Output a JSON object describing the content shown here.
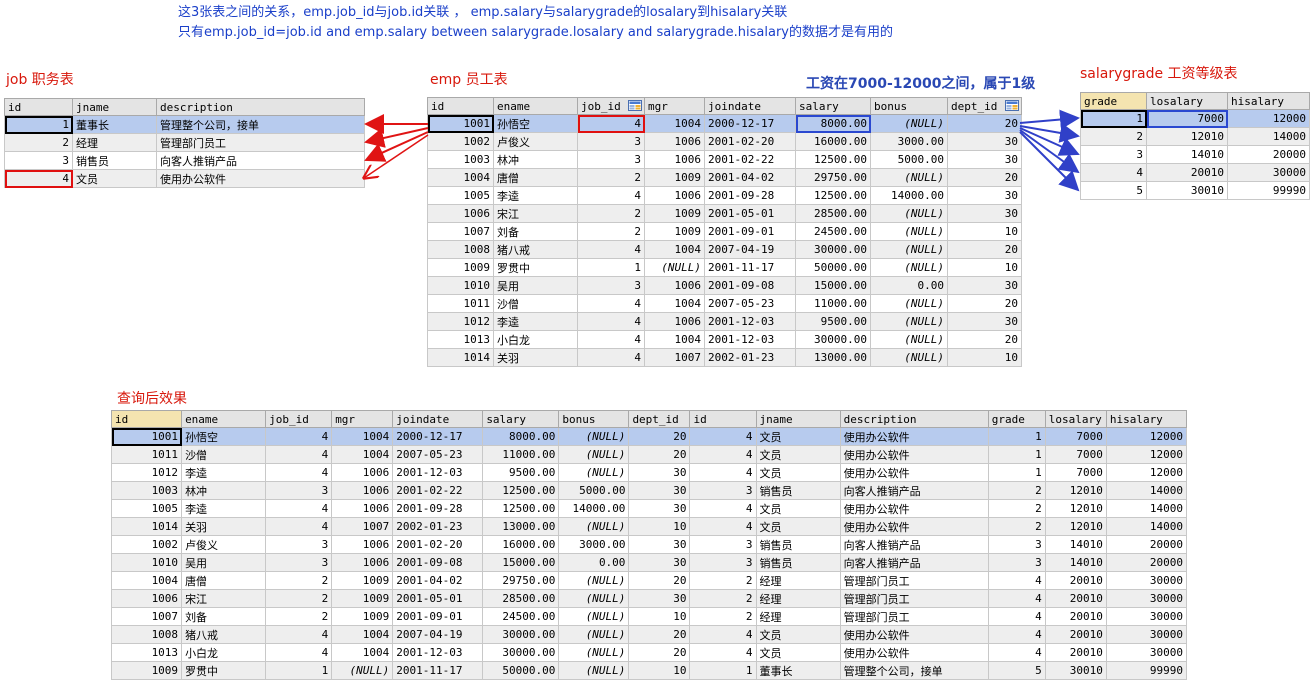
{
  "notes": {
    "line1": "这3张表之间的关系，emp.job_id与job.id关联 ， emp.salary与salarygrade的losalary到hisalary关联",
    "line2": "只有emp.job_id=job.id and emp.salary between salarygrade.losalary and salarygrade.hisalary的数据才是有用的"
  },
  "labels": {
    "job": "job 职务表",
    "emp": "emp 员工表",
    "grade_note": "工资在7000-12000之间，属于1级",
    "salarygrade": "salarygrade 工资等级表",
    "result": "查询后效果"
  },
  "colors": {
    "accent_red": "#d8180c",
    "accent_blue": "#2a48d0",
    "selected_row": "#b7cbee",
    "sorted_header": "#f4e4b0"
  },
  "job_table": {
    "columns": [
      "id",
      "jname",
      "description"
    ],
    "rows": [
      [
        "1",
        "董事长",
        "管理整个公司，接单"
      ],
      [
        "2",
        "经理",
        "管理部门员工"
      ],
      [
        "3",
        "销售员",
        "向客人推销产品"
      ],
      [
        "4",
        "文员",
        "使用办公软件"
      ]
    ]
  },
  "emp_table": {
    "columns": [
      "id",
      "ename",
      "job_id",
      "mgr",
      "joindate",
      "salary",
      "bonus",
      "dept_id"
    ],
    "rows": [
      [
        "1001",
        "孙悟空",
        "4",
        "1004",
        "2000-12-17",
        "8000.00",
        "(NULL)",
        "20"
      ],
      [
        "1002",
        "卢俊义",
        "3",
        "1006",
        "2001-02-20",
        "16000.00",
        "3000.00",
        "30"
      ],
      [
        "1003",
        "林冲",
        "3",
        "1006",
        "2001-02-22",
        "12500.00",
        "5000.00",
        "30"
      ],
      [
        "1004",
        "唐僧",
        "2",
        "1009",
        "2001-04-02",
        "29750.00",
        "(NULL)",
        "20"
      ],
      [
        "1005",
        "李逵",
        "4",
        "1006",
        "2001-09-28",
        "12500.00",
        "14000.00",
        "30"
      ],
      [
        "1006",
        "宋江",
        "2",
        "1009",
        "2001-05-01",
        "28500.00",
        "(NULL)",
        "30"
      ],
      [
        "1007",
        "刘备",
        "2",
        "1009",
        "2001-09-01",
        "24500.00",
        "(NULL)",
        "10"
      ],
      [
        "1008",
        "猪八戒",
        "4",
        "1004",
        "2007-04-19",
        "30000.00",
        "(NULL)",
        "20"
      ],
      [
        "1009",
        "罗贯中",
        "1",
        "(NULL)",
        "2001-11-17",
        "50000.00",
        "(NULL)",
        "10"
      ],
      [
        "1010",
        "吴用",
        "3",
        "1006",
        "2001-09-08",
        "15000.00",
        "0.00",
        "30"
      ],
      [
        "1011",
        "沙僧",
        "4",
        "1004",
        "2007-05-23",
        "11000.00",
        "(NULL)",
        "20"
      ],
      [
        "1012",
        "李逵",
        "4",
        "1006",
        "2001-12-03",
        "9500.00",
        "(NULL)",
        "30"
      ],
      [
        "1013",
        "小白龙",
        "4",
        "1004",
        "2001-12-03",
        "30000.00",
        "(NULL)",
        "20"
      ],
      [
        "1014",
        "关羽",
        "4",
        "1007",
        "2002-01-23",
        "13000.00",
        "(NULL)",
        "10"
      ]
    ]
  },
  "salarygrade_table": {
    "columns": [
      "grade",
      "losalary",
      "hisalary"
    ],
    "rows": [
      [
        "1",
        "7000",
        "12000"
      ],
      [
        "2",
        "12010",
        "14000"
      ],
      [
        "3",
        "14010",
        "20000"
      ],
      [
        "4",
        "20010",
        "30000"
      ],
      [
        "5",
        "30010",
        "99990"
      ]
    ]
  },
  "result_table": {
    "columns": [
      "id",
      "ename",
      "job_id",
      "mgr",
      "joindate",
      "salary",
      "bonus",
      "dept_id",
      "id",
      "jname",
      "description",
      "grade",
      "losalary",
      "hisalary"
    ],
    "rows": [
      [
        "1001",
        "孙悟空",
        "4",
        "1004",
        "2000-12-17",
        "8000.00",
        "(NULL)",
        "20",
        "4",
        "文员",
        "使用办公软件",
        "1",
        "7000",
        "12000"
      ],
      [
        "1011",
        "沙僧",
        "4",
        "1004",
        "2007-05-23",
        "11000.00",
        "(NULL)",
        "20",
        "4",
        "文员",
        "使用办公软件",
        "1",
        "7000",
        "12000"
      ],
      [
        "1012",
        "李逵",
        "4",
        "1006",
        "2001-12-03",
        "9500.00",
        "(NULL)",
        "30",
        "4",
        "文员",
        "使用办公软件",
        "1",
        "7000",
        "12000"
      ],
      [
        "1003",
        "林冲",
        "3",
        "1006",
        "2001-02-22",
        "12500.00",
        "5000.00",
        "30",
        "3",
        "销售员",
        "向客人推销产品",
        "2",
        "12010",
        "14000"
      ],
      [
        "1005",
        "李逵",
        "4",
        "1006",
        "2001-09-28",
        "12500.00",
        "14000.00",
        "30",
        "4",
        "文员",
        "使用办公软件",
        "2",
        "12010",
        "14000"
      ],
      [
        "1014",
        "关羽",
        "4",
        "1007",
        "2002-01-23",
        "13000.00",
        "(NULL)",
        "10",
        "4",
        "文员",
        "使用办公软件",
        "2",
        "12010",
        "14000"
      ],
      [
        "1002",
        "卢俊义",
        "3",
        "1006",
        "2001-02-20",
        "16000.00",
        "3000.00",
        "30",
        "3",
        "销售员",
        "向客人推销产品",
        "3",
        "14010",
        "20000"
      ],
      [
        "1010",
        "吴用",
        "3",
        "1006",
        "2001-09-08",
        "15000.00",
        "0.00",
        "30",
        "3",
        "销售员",
        "向客人推销产品",
        "3",
        "14010",
        "20000"
      ],
      [
        "1004",
        "唐僧",
        "2",
        "1009",
        "2001-04-02",
        "29750.00",
        "(NULL)",
        "20",
        "2",
        "经理",
        "管理部门员工",
        "4",
        "20010",
        "30000"
      ],
      [
        "1006",
        "宋江",
        "2",
        "1009",
        "2001-05-01",
        "28500.00",
        "(NULL)",
        "30",
        "2",
        "经理",
        "管理部门员工",
        "4",
        "20010",
        "30000"
      ],
      [
        "1007",
        "刘备",
        "2",
        "1009",
        "2001-09-01",
        "24500.00",
        "(NULL)",
        "10",
        "2",
        "经理",
        "管理部门员工",
        "4",
        "20010",
        "30000"
      ],
      [
        "1008",
        "猪八戒",
        "4",
        "1004",
        "2007-04-19",
        "30000.00",
        "(NULL)",
        "20",
        "4",
        "文员",
        "使用办公软件",
        "4",
        "20010",
        "30000"
      ],
      [
        "1013",
        "小白龙",
        "4",
        "1004",
        "2001-12-03",
        "30000.00",
        "(NULL)",
        "20",
        "4",
        "文员",
        "使用办公软件",
        "4",
        "20010",
        "30000"
      ],
      [
        "1009",
        "罗贯中",
        "1",
        "(NULL)",
        "2001-11-17",
        "50000.00",
        "(NULL)",
        "10",
        "1",
        "董事长",
        "管理整个公司，接单",
        "5",
        "30010",
        "99990"
      ]
    ]
  }
}
